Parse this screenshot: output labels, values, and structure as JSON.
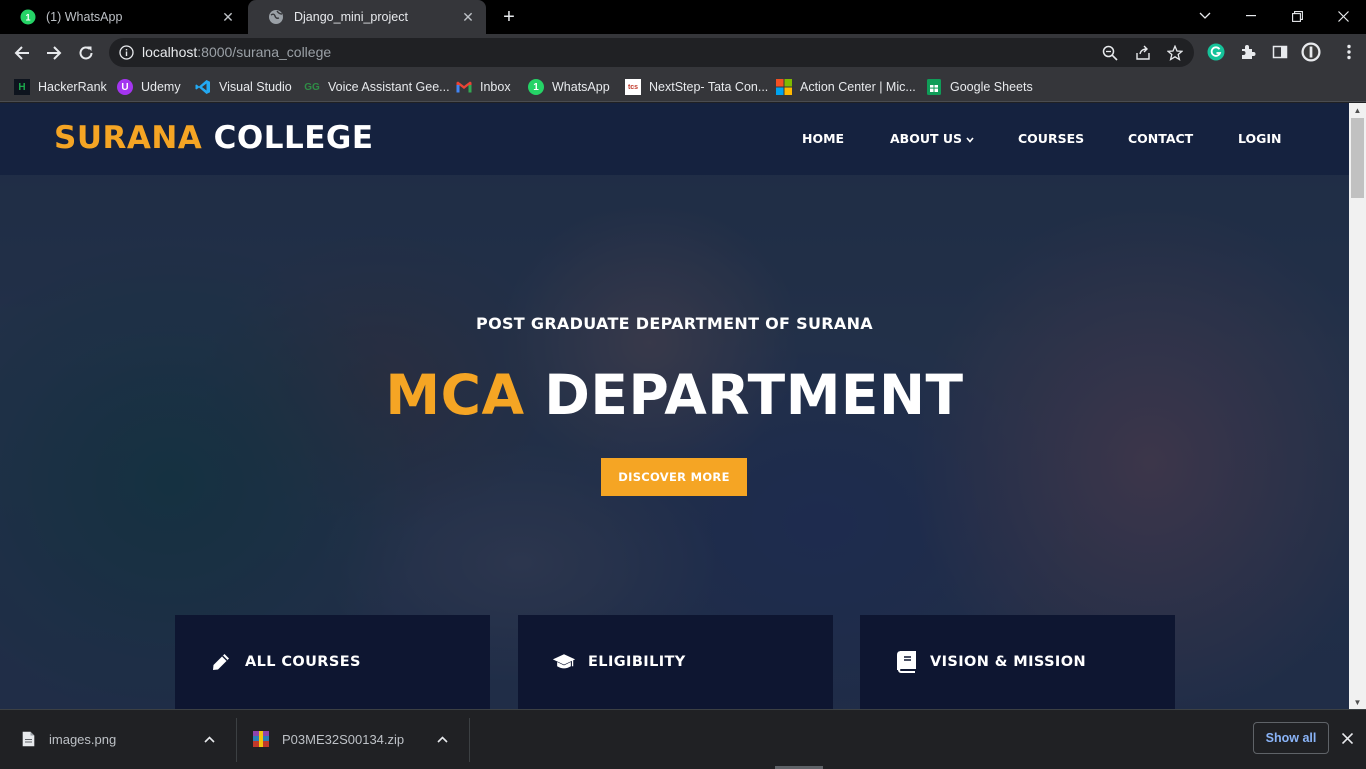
{
  "browser": {
    "tabs": [
      {
        "title": "(1) WhatsApp",
        "badge": "1",
        "active": false
      },
      {
        "title": "Django_mini_project",
        "active": true
      }
    ],
    "new_tab_symbol": "+",
    "url_host": "localhost",
    "url_rest": ":8000/surana_college",
    "bookmarks": [
      {
        "label": "HackerRank",
        "icon": "hackerrank-icon",
        "color": "#1ba94c"
      },
      {
        "label": "Udemy",
        "icon": "udemy-icon",
        "color": "#a435f0"
      },
      {
        "label": "Visual Studio",
        "icon": "visual-studio-icon",
        "color": "#0078d4"
      },
      {
        "label": "Voice Assistant Gee...",
        "icon": "geeksforgeeks-icon",
        "color": "#2f8d46"
      },
      {
        "label": "Inbox",
        "icon": "gmail-icon",
        "color": "#ea4335"
      },
      {
        "label": "WhatsApp",
        "icon": "whatsapp-icon",
        "color": "#25d366"
      },
      {
        "label": "NextStep- Tata Con...",
        "icon": "tcs-icon",
        "color": "#e8eaed"
      },
      {
        "label": "Action Center | Mic...",
        "icon": "microsoft-icon",
        "color": "#f25022"
      },
      {
        "label": "Google Sheets",
        "icon": "google-sheets-icon",
        "color": "#0f9d58"
      }
    ]
  },
  "site": {
    "logo_accent": "SURANA",
    "logo_plain": "COLLEGE",
    "nav": [
      "HOME",
      "ABOUT US",
      "COURSES",
      "CONTACT",
      "LOGIN"
    ],
    "hero_subtitle": "POST GRADUATE DEPARTMENT OF SURANA",
    "hero_title_accent": "MCA",
    "hero_title_plain": "DEPARTMENT",
    "cta_label": "DISCOVER MORE",
    "features": [
      {
        "label": "ALL COURSES",
        "icon": "pencil-icon"
      },
      {
        "label": "ELIGIBILITY",
        "icon": "graduation-cap-icon"
      },
      {
        "label": "VISION & MISSION",
        "icon": "book-icon"
      }
    ],
    "colors": {
      "accent": "#f5a524",
      "header": "#15223f",
      "feature_box": "#0e1631"
    }
  },
  "downloads": {
    "items": [
      {
        "name": "images.png",
        "icon": "file-icon"
      },
      {
        "name": "P03ME32S00134.zip",
        "icon": "winrar-icon"
      }
    ],
    "show_all_label": "Show all"
  }
}
